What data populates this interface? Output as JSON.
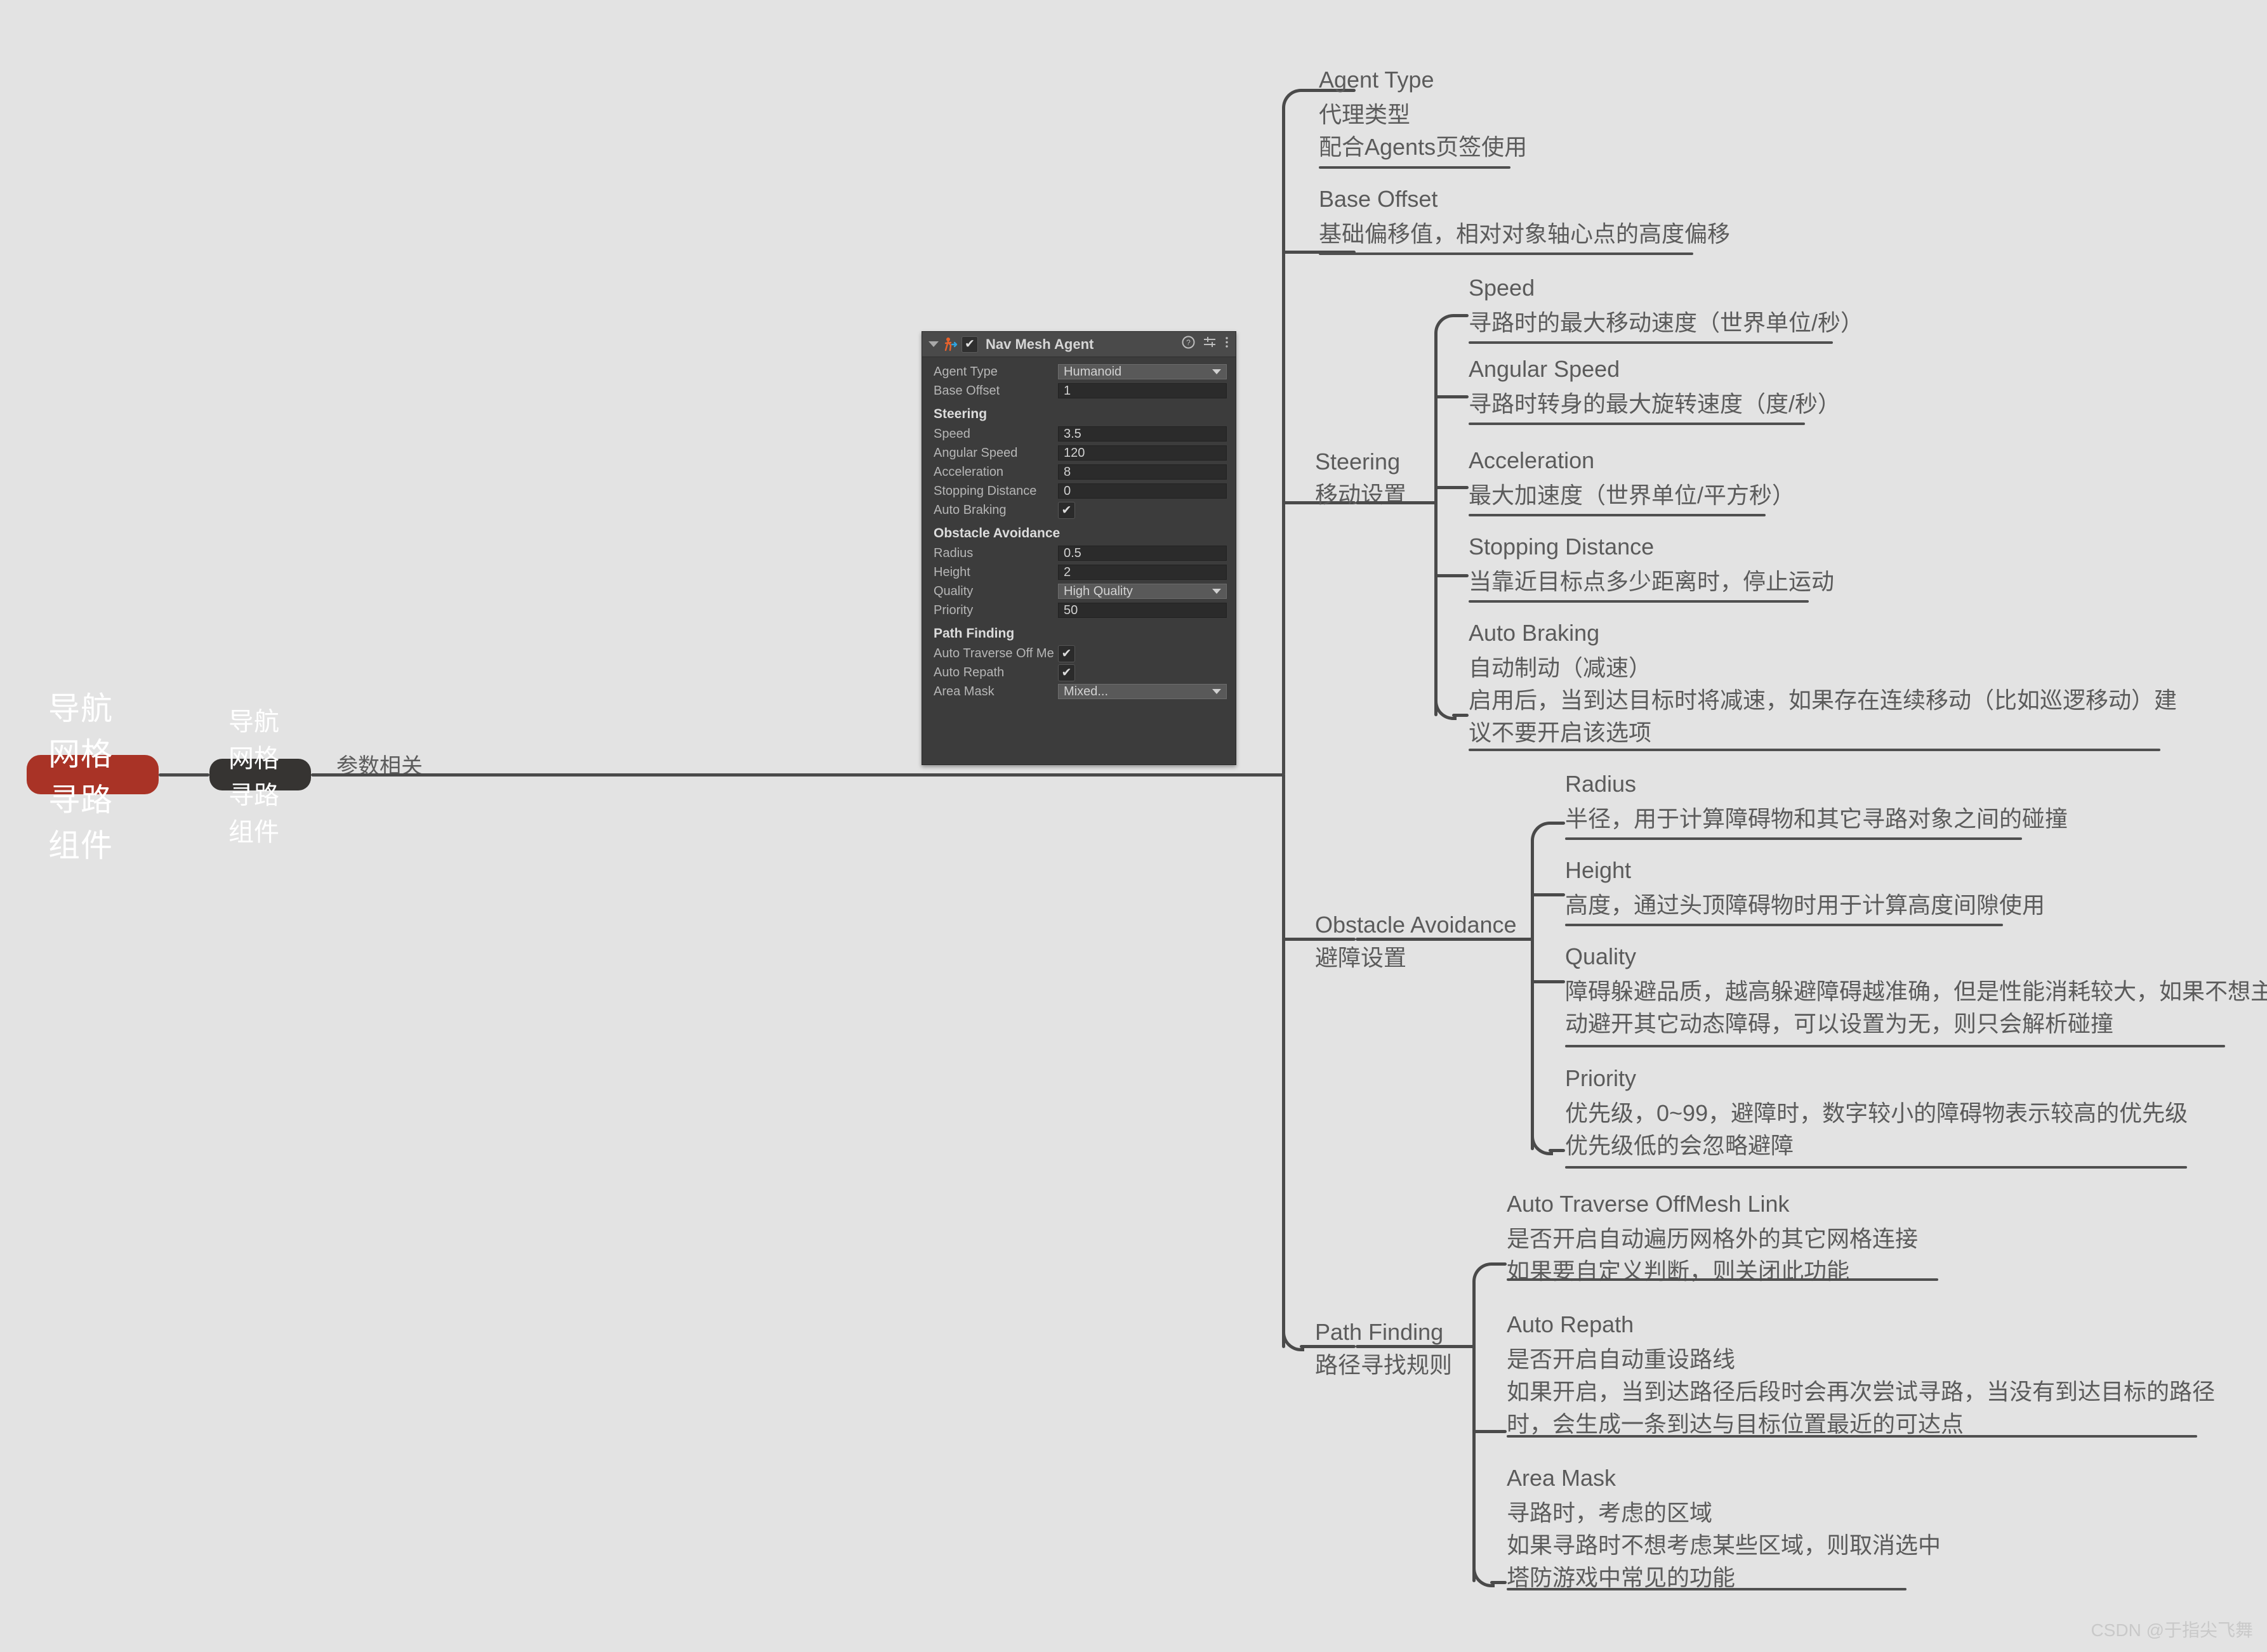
{
  "mindmap": {
    "root": {
      "label": "导航网格寻路组件"
    },
    "level1": {
      "label": "导航网格寻路组件"
    },
    "edge_label": "参数相关",
    "branches": [
      {
        "en": "Agent Type",
        "cn": "代理类型",
        "lines": [
          "配合Agents页签使用"
        ]
      },
      {
        "en": "Base Offset",
        "cn": "",
        "lines": [
          "基础偏移值，相对对象轴心点的高度偏移"
        ]
      },
      {
        "en": "Steering",
        "cn": "移动设置",
        "children": [
          {
            "title": "Speed",
            "lines": [
              "寻路时的最大移动速度（世界单位/秒）"
            ]
          },
          {
            "title": "Angular Speed",
            "lines": [
              "寻路时转身的最大旋转速度（度/秒）"
            ]
          },
          {
            "title": "Acceleration",
            "lines": [
              "最大加速度（世界单位/平方秒）"
            ]
          },
          {
            "title": "Stopping Distance",
            "lines": [
              "当靠近目标点多少距离时，停止运动"
            ]
          },
          {
            "title": "Auto Braking",
            "lines": [
              "自动制动（减速）",
              "启用后，当到达目标时将减速，如果存在连续移动（比如巡逻移动）建",
              "议不要开启该选项"
            ]
          }
        ]
      },
      {
        "en": "Obstacle Avoidance",
        "cn": "避障设置",
        "children": [
          {
            "title": "Radius",
            "lines": [
              "半径，用于计算障碍物和其它寻路对象之间的碰撞"
            ]
          },
          {
            "title": "Height",
            "lines": [
              "高度，通过头顶障碍物时用于计算高度间隙使用"
            ]
          },
          {
            "title": "Quality",
            "lines": [
              "障碍躲避品质，越高躲避障碍越准确，但是性能消耗较大，如果不想主",
              "动避开其它动态障碍，可以设置为无，则只会解析碰撞"
            ]
          },
          {
            "title": "Priority",
            "lines": [
              "优先级，0~99，避障时，数字较小的障碍物表示较高的优先级",
              "优先级低的会忽略避障"
            ]
          }
        ]
      },
      {
        "en": "Path Finding",
        "cn": "路径寻找规则",
        "children": [
          {
            "title": "Auto Traverse OffMesh Link",
            "lines": [
              "是否开启自动遍历网格外的其它网格连接",
              "如果要自定义判断，则关闭此功能"
            ]
          },
          {
            "title": "Auto Repath",
            "lines": [
              "是否开启自动重设路线",
              "如果开启，当到达路径后段时会再次尝试寻路，当没有到达目标的路径",
              "时，会生成一条到达与目标位置最近的可达点"
            ]
          },
          {
            "title": "Area Mask",
            "lines": [
              "寻路时，考虑的区域",
              "如果寻路时不想考虑某些区域，则取消选中",
              "塔防游戏中常见的功能"
            ]
          }
        ]
      }
    ]
  },
  "inspector": {
    "title": "Nav Mesh Agent",
    "icons": {
      "collapse": "triangle-down-icon",
      "component": "nav-mesh-agent-icon",
      "enabled": "✔",
      "help": "?",
      "preset": "preset-icon",
      "menu": "⋮"
    },
    "rows": [
      {
        "label": "Agent Type",
        "value": "Humanoid",
        "type": "popup"
      },
      {
        "label": "Base Offset",
        "value": "1",
        "type": "text"
      }
    ],
    "sections": [
      {
        "header": "Steering",
        "rows": [
          {
            "label": "Speed",
            "value": "3.5",
            "type": "text"
          },
          {
            "label": "Angular Speed",
            "value": "120",
            "type": "text"
          },
          {
            "label": "Acceleration",
            "value": "8",
            "type": "text"
          },
          {
            "label": "Stopping Distance",
            "value": "0",
            "type": "text"
          },
          {
            "label": "Auto Braking",
            "value": "✔",
            "type": "check"
          }
        ]
      },
      {
        "header": "Obstacle Avoidance",
        "rows": [
          {
            "label": "Radius",
            "value": "0.5",
            "type": "text"
          },
          {
            "label": "Height",
            "value": "2",
            "type": "text"
          },
          {
            "label": "Quality",
            "value": "High Quality",
            "type": "popup"
          },
          {
            "label": "Priority",
            "value": "50",
            "type": "text"
          }
        ]
      },
      {
        "header": "Path Finding",
        "rows": [
          {
            "label": "Auto Traverse Off Me",
            "value": "✔",
            "type": "check"
          },
          {
            "label": "Auto Repath",
            "value": "✔",
            "type": "check"
          },
          {
            "label": "Area Mask",
            "value": "Mixed...",
            "type": "popup"
          }
        ]
      }
    ]
  },
  "watermark": "CSDN @于指尖飞舞",
  "colors": {
    "background": "#e3e3e3",
    "root": "#a93326",
    "node_dark": "#363432",
    "text": "#5b5b5b",
    "line": "#4a4a4a"
  }
}
